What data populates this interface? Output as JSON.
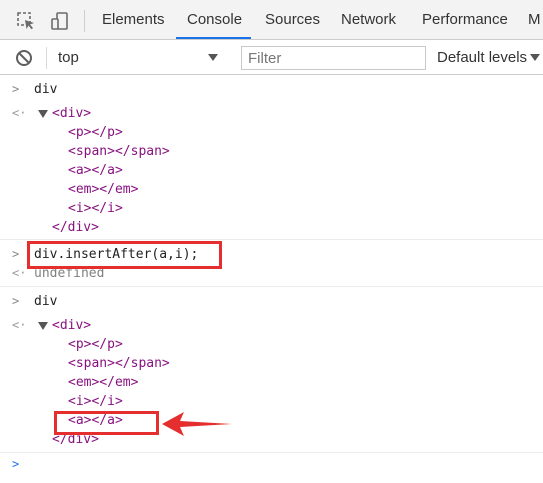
{
  "tabs": {
    "items": [
      "Elements",
      "Console",
      "Sources",
      "Network",
      "Performance",
      "M"
    ],
    "active": "Console"
  },
  "toolbar": {
    "context_value": "top",
    "filter_placeholder": "Filter",
    "levels_label": "Default levels"
  },
  "console": {
    "block1": {
      "input": "div",
      "tree": [
        "<div>",
        "<p></p>",
        "<span></span>",
        "<a></a>",
        "<em></em>",
        "<i></i>",
        "</div>"
      ]
    },
    "block2": {
      "input": "div.insertAfter(a,i);",
      "result": "undefined"
    },
    "block3": {
      "input": "div",
      "tree": [
        "<div>",
        "<p></p>",
        "<span></span>",
        "<em></em>",
        "<i></i>",
        "<a></a>",
        "</div>"
      ]
    }
  },
  "colors": {
    "tag": "#881280",
    "highlight": "#e52e2e",
    "accent": "#1a73e8"
  }
}
